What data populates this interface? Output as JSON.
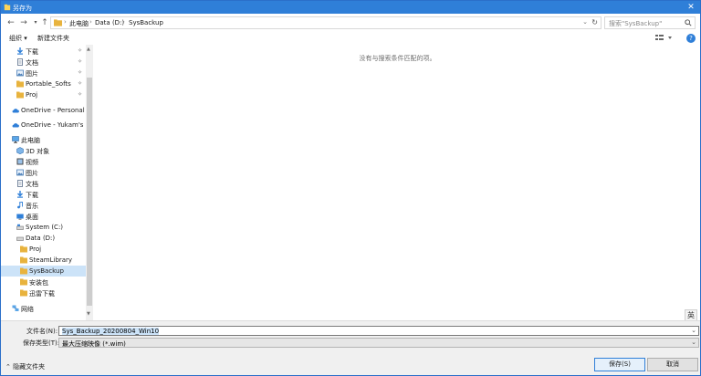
{
  "window": {
    "title": "另存为"
  },
  "address": {
    "crumbs": [
      "此电脑",
      "Data (D:)",
      "SysBackup"
    ],
    "search_placeholder": "搜索\"SysBackup\""
  },
  "toolbar": {
    "organize": "组织 ▾",
    "new_folder": "新建文件夹"
  },
  "nav": {
    "quick": [
      {
        "label": "下载",
        "icon": "download-icon"
      },
      {
        "label": "文档",
        "icon": "document-icon"
      },
      {
        "label": "图片",
        "icon": "picture-icon"
      },
      {
        "label": "Portable_Softs",
        "icon": "folder-icon"
      },
      {
        "label": "Proj",
        "icon": "folder-icon"
      }
    ],
    "onedrive_personal": "OneDrive - Personal",
    "onedrive_org": "OneDrive - Yukam's Ma",
    "this_pc": "此电脑",
    "pc_items": [
      {
        "label": "3D 对象",
        "icon": "3d-objects-icon"
      },
      {
        "label": "视频",
        "icon": "video-icon"
      },
      {
        "label": "图片",
        "icon": "picture-icon"
      },
      {
        "label": "文档",
        "icon": "document-icon"
      },
      {
        "label": "下载",
        "icon": "download-icon"
      },
      {
        "label": "音乐",
        "icon": "music-icon"
      },
      {
        "label": "桌面",
        "icon": "desktop-icon"
      }
    ],
    "system_drive": "System (C:)",
    "data_drive": "Data (D:)",
    "data_folders": [
      "Proj",
      "SteamLibrary",
      "SysBackup",
      "安装包",
      "迅雷下载"
    ],
    "network": "网络"
  },
  "content": {
    "empty_text": "没有与搜索条件匹配的项。",
    "ime": "英"
  },
  "form": {
    "filename_label": "文件名(N):",
    "filename_value": "Sys_Backup_20200804_Win10",
    "type_label": "保存类型(T):",
    "type_value": "最大压缩映像 (*.wim)"
  },
  "footer": {
    "hide_folders": "隐藏文件夹",
    "save": "保存(S)",
    "cancel": "取消"
  },
  "colors": {
    "accent": "#2f7fd8",
    "selection": "#cce3f8",
    "folder": "#e8b33e"
  }
}
